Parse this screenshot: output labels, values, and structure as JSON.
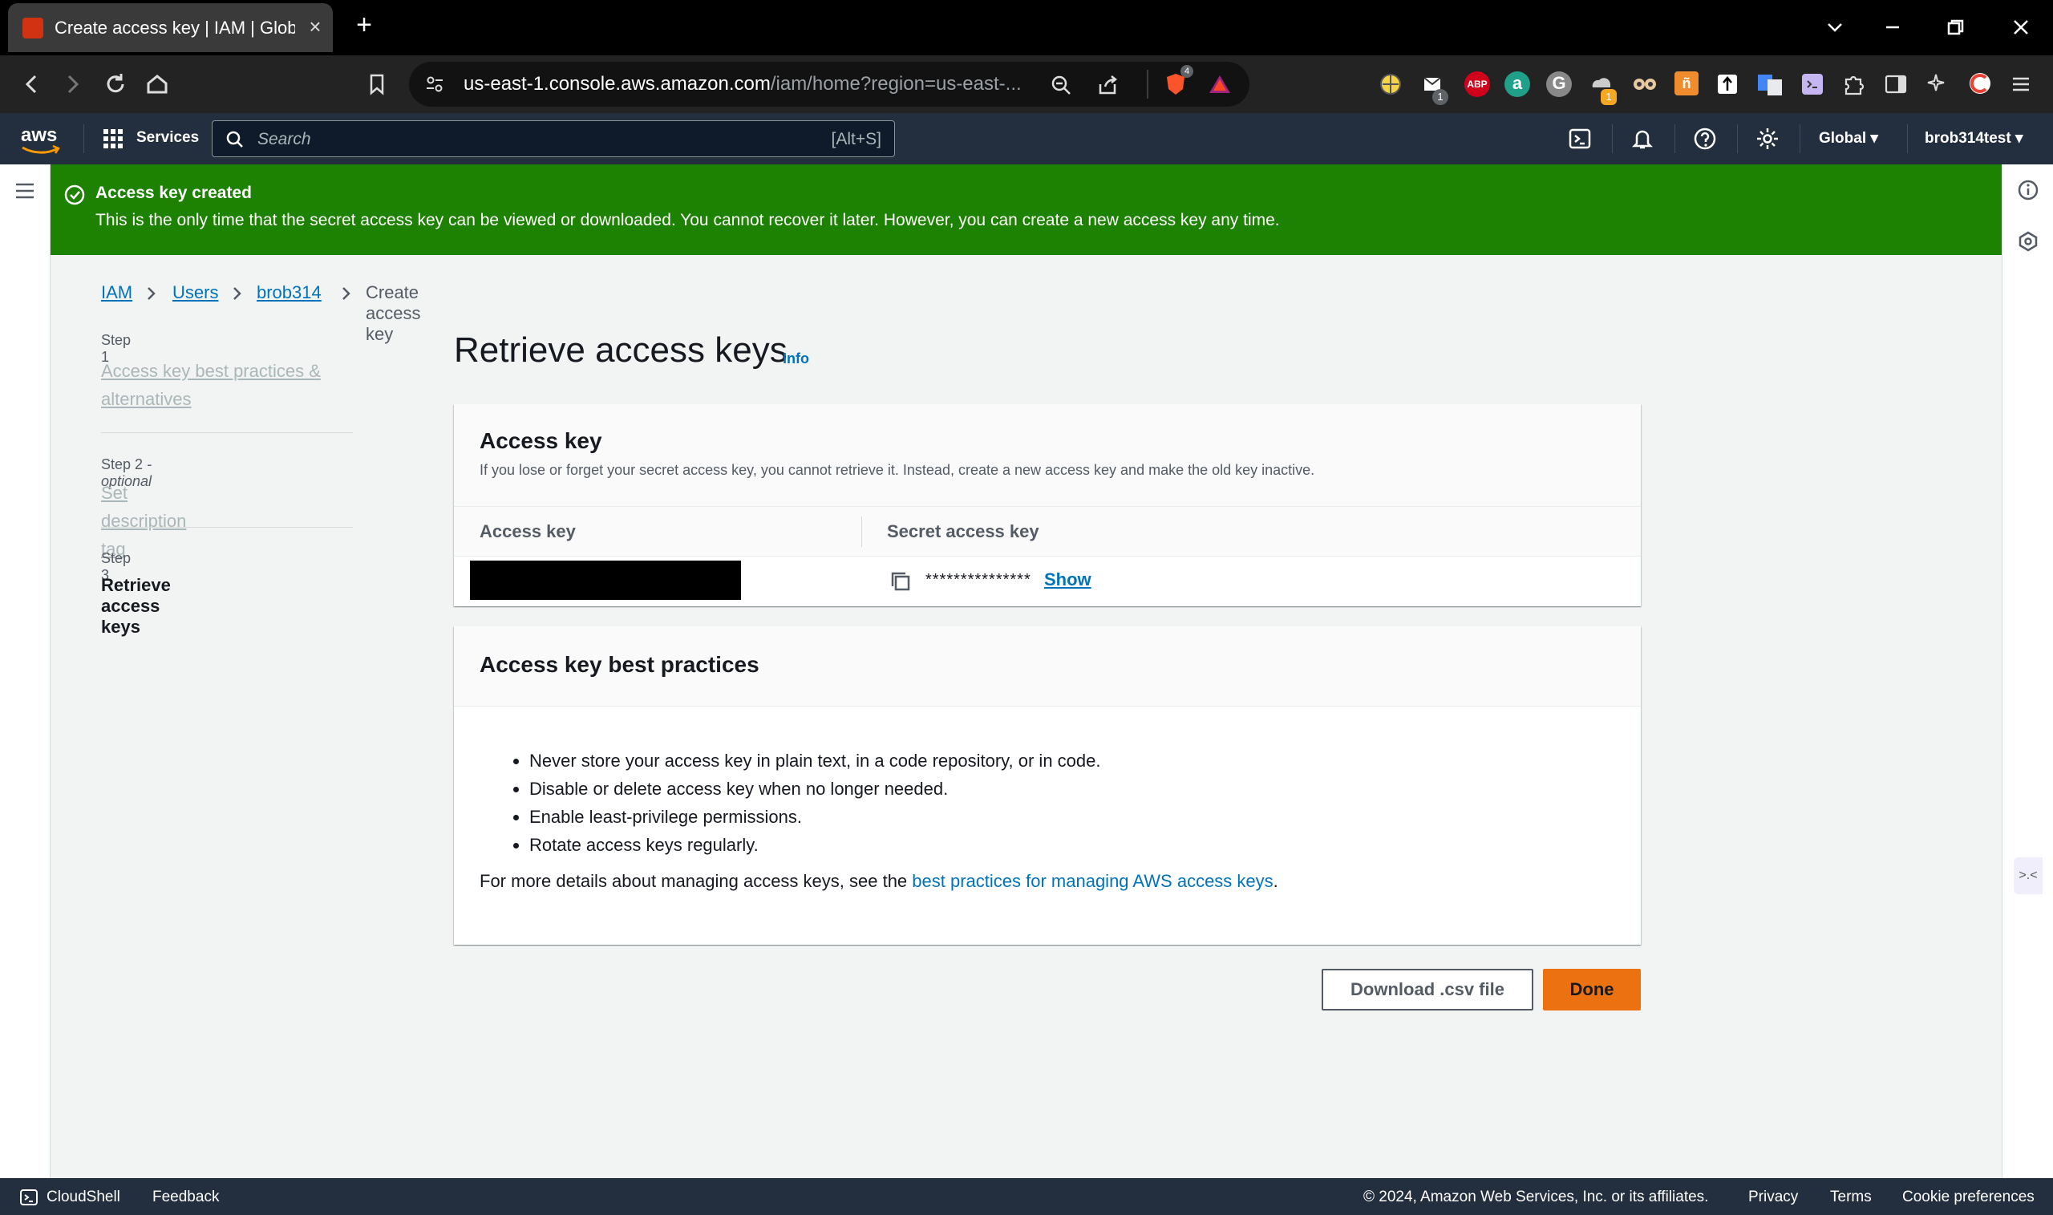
{
  "browser": {
    "tab_title": "Create access key | IAM | Global",
    "url_host": "us-east-1.console.aws.amazon.com",
    "url_path": "/iam/home?region=us-east-...",
    "shield_badge": "4",
    "ext_badge_1": "1",
    "ext_badge_2": "1",
    "abp_label": "ABP"
  },
  "aws_nav": {
    "logo": "aws",
    "services_label": "Services",
    "search_placeholder": "Search",
    "search_shortcut": "[Alt+S]",
    "region": "Global ▾",
    "account": "brob314test ▾"
  },
  "flash": {
    "title": "Access key created",
    "message": "This is the only time that the secret access key can be viewed or downloaded. You cannot recover it later. However, you can create a new access key any time."
  },
  "breadcrumb": {
    "items": [
      "IAM",
      "Users",
      "brob314"
    ],
    "current": "Create access key"
  },
  "steps": [
    {
      "label": "Step 1",
      "title": "Access key best practices & alternatives"
    },
    {
      "label": "Step 2",
      "optional": "- optional",
      "title": "Set description tag"
    },
    {
      "label": "Step 3",
      "title": "Retrieve access keys"
    }
  ],
  "main": {
    "title": "Retrieve access keys",
    "info": "Info",
    "access_key_card": {
      "title": "Access key",
      "description": "If you lose or forget your secret access key, you cannot retrieve it. Instead, create a new access key and make the old key inactive.",
      "col_access_key": "Access key",
      "col_secret": "Secret access key",
      "secret_masked": "***************",
      "show_label": "Show"
    },
    "best_practices": {
      "title": "Access key best practices",
      "items": [
        "Never store your access key in plain text, in a code repository, or in code.",
        "Disable or delete access key when no longer needed.",
        "Enable least-privilege permissions.",
        "Rotate access keys regularly."
      ],
      "footer_prefix": "For more details about managing access keys, see the ",
      "footer_link": "best practices for managing AWS access keys",
      "footer_suffix": "."
    },
    "buttons": {
      "download": "Download .csv file",
      "done": "Done"
    }
  },
  "footer": {
    "cloudshell": "CloudShell",
    "feedback": "Feedback",
    "copyright": "© 2024, Amazon Web Services, Inc. or its affiliates.",
    "privacy": "Privacy",
    "terms": "Terms",
    "cookies": "Cookie preferences"
  },
  "colors": {
    "success": "#1d8102",
    "link": "#0073bb",
    "primary_button": "#ec7211",
    "nav_bg": "#232f3e"
  }
}
